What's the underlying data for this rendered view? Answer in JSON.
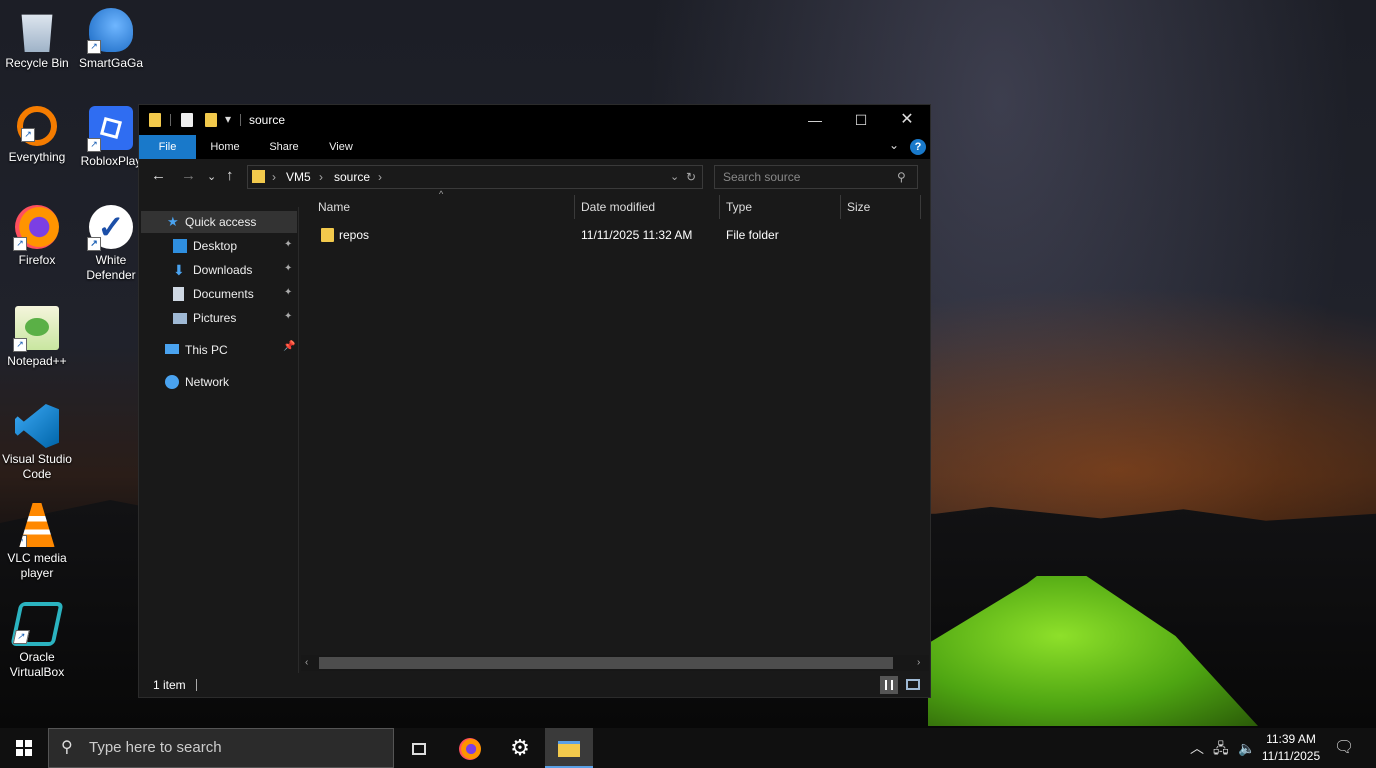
{
  "desktop": {
    "icons": [
      {
        "label": "Recycle Bin",
        "icon": "recycle-bin-icon"
      },
      {
        "label": "SmartGaGa",
        "icon": "swan-icon"
      },
      {
        "label": "Everything",
        "icon": "magnifier-icon"
      },
      {
        "label": "RobloxPlay",
        "icon": "roblox-icon"
      },
      {
        "label": "Firefox",
        "icon": "firefox-icon"
      },
      {
        "label": "White Defender",
        "icon": "checkmark-shield-icon"
      },
      {
        "label": "Notepad++",
        "icon": "notepad-plus-plus-icon"
      },
      {
        "label": "Visual Studio Code",
        "icon": "vscode-icon"
      },
      {
        "label": "VLC media player",
        "icon": "vlc-cone-icon"
      },
      {
        "label": "Oracle VirtualBox",
        "icon": "virtualbox-icon"
      }
    ]
  },
  "explorer": {
    "title": "source",
    "ribbon_tabs": [
      "File",
      "Home",
      "Share",
      "View"
    ],
    "address": {
      "segments": [
        "VM5",
        "source"
      ]
    },
    "search_placeholder": "Search source",
    "nav": {
      "quick_access": "Quick access",
      "pinned": [
        "Desktop",
        "Downloads",
        "Documents",
        "Pictures"
      ],
      "this_pc": "This PC",
      "network": "Network"
    },
    "columns": [
      "Name",
      "Date modified",
      "Type",
      "Size"
    ],
    "rows": [
      {
        "name": "repos",
        "date": "11/11/2025 11:32 AM",
        "type": "File folder",
        "size": ""
      }
    ],
    "status": "1 item",
    "colors": {
      "file_tab": "#1979ca",
      "folder": "#f2c94c",
      "accent": "#5aa0e6"
    }
  },
  "taskbar": {
    "search_placeholder": "Type here to search",
    "time": "11:39 AM",
    "date": "11/11/2025"
  }
}
